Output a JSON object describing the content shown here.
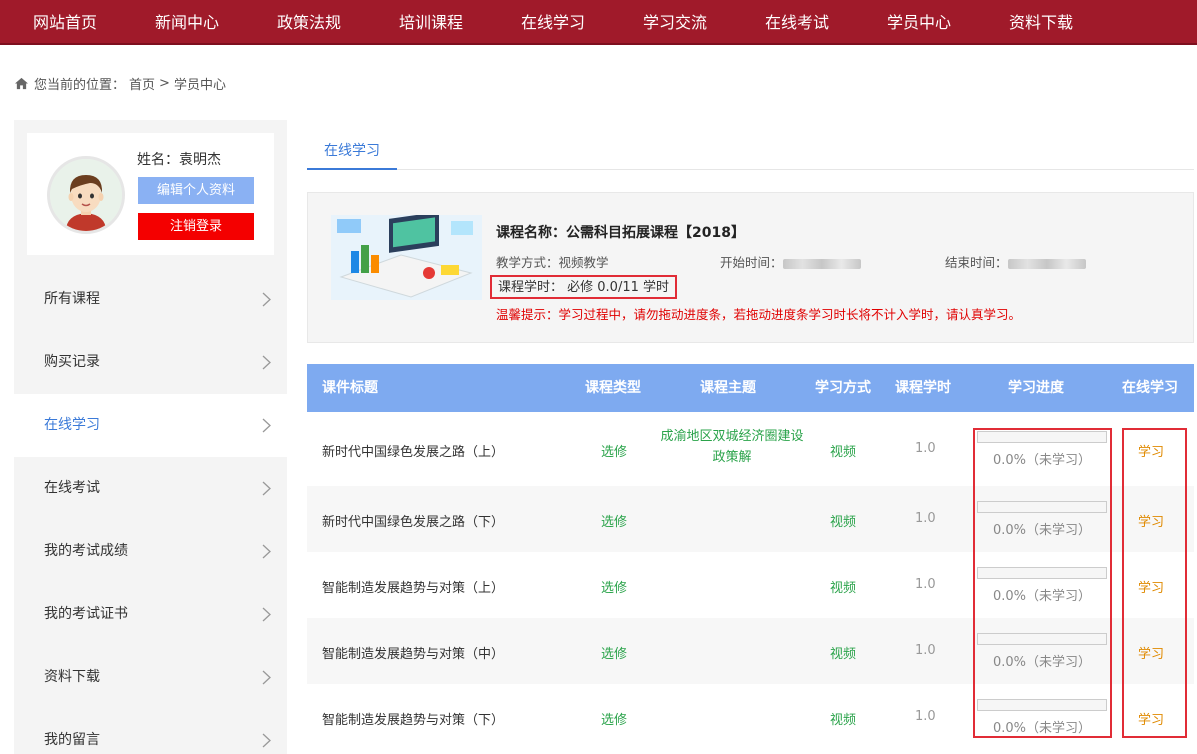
{
  "nav": {
    "items": [
      "网站首页",
      "新闻中心",
      "政策法规",
      "培训课程",
      "在线学习",
      "学习交流",
      "在线考试",
      "学员中心",
      "资料下载"
    ]
  },
  "breadcrumb": {
    "prefix": "您当前的位置：",
    "home": "首页",
    "separator": ">",
    "current": "学员中心"
  },
  "profile": {
    "name_label": "姓名：袁明杰",
    "edit_label": "编辑个人资料",
    "logout_label": "注销登录"
  },
  "sidebar": {
    "items": [
      {
        "label": "所有课程"
      },
      {
        "label": "购买记录"
      },
      {
        "label": "在线学习"
      },
      {
        "label": "在线考试"
      },
      {
        "label": "我的考试成绩"
      },
      {
        "label": "我的考试证书"
      },
      {
        "label": "资料下载"
      },
      {
        "label": "我的留言"
      }
    ],
    "active_index": 2
  },
  "tabs": {
    "active_label": "在线学习"
  },
  "course": {
    "title": "课程名称：公需科目拓展课程【2018】",
    "mode": "教学方式：视频教学",
    "start_label": "开始时间：",
    "end_label": "结束时间：",
    "hours": "课程学时： 必修 0.0/11 学时",
    "tip": "温馨提示：学习过程中，请勿拖动进度条，若拖动进度条学习时长将不计入学时，请认真学习。"
  },
  "table": {
    "headers": {
      "title": "课件标题",
      "type": "课程类型",
      "topic": "课程主题",
      "mode": "学习方式",
      "hours": "课程学时",
      "progress": "学习进度",
      "learn": "在线学习"
    },
    "rows": [
      {
        "title": "新时代中国绿色发展之路（上）",
        "type": "选修",
        "topic": "成渝地区双城经济圈建设政策解",
        "mode": "视频",
        "hours": "1.0",
        "progress": 0.0,
        "progress_text": "0.0%（未学习）",
        "learn": "学习"
      },
      {
        "title": "新时代中国绿色发展之路（下）",
        "type": "选修",
        "topic": "",
        "mode": "视频",
        "hours": "1.0",
        "progress": 0.0,
        "progress_text": "0.0%（未学习）",
        "learn": "学习"
      },
      {
        "title": "智能制造发展趋势与对策（上）",
        "type": "选修",
        "topic": "",
        "mode": "视频",
        "hours": "1.0",
        "progress": 0.0,
        "progress_text": "0.0%（未学习）",
        "learn": "学习"
      },
      {
        "title": "智能制造发展趋势与对策（中）",
        "type": "选修",
        "topic": "",
        "mode": "视频",
        "hours": "1.0",
        "progress": 0.0,
        "progress_text": "0.0%（未学习）",
        "learn": "学习"
      },
      {
        "title": "智能制造发展趋势与对策（下）",
        "type": "选修",
        "topic": "",
        "mode": "视频",
        "hours": "1.0",
        "progress": 0.0,
        "progress_text": "0.0%（未学习）",
        "learn": "学习"
      }
    ]
  },
  "colors": {
    "nav_bg": "#a01a2a",
    "accent": "#3b7ad8",
    "table_header": "#7eaaf0",
    "highlight_border": "#e12c36",
    "green_text": "#2aa34a",
    "learn_link": "#e08a00"
  }
}
